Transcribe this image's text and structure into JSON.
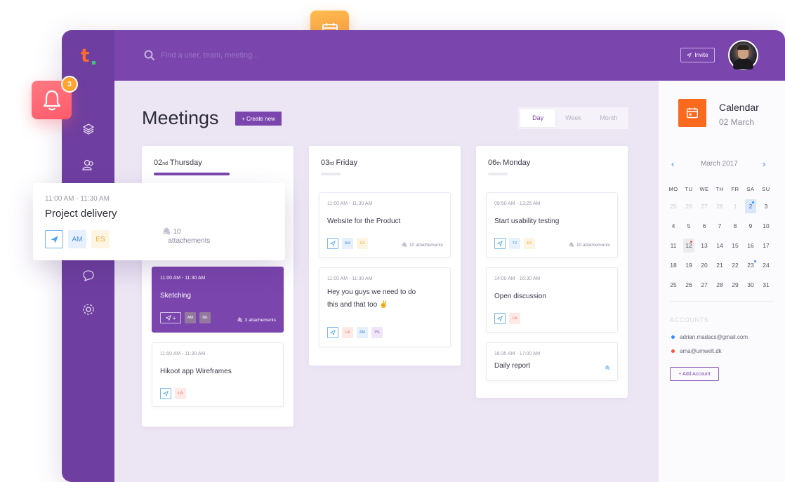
{
  "app": {
    "logo_letter": "t",
    "brand_color": "#7a45ad",
    "accent_color": "#fa6a1e"
  },
  "topbar": {
    "search_placeholder": "Find a user, team, meeting...",
    "invite_label": "Invite"
  },
  "sidebar": {
    "icons": [
      "layers-icon",
      "users-icon",
      "chat-icon",
      "settings-icon"
    ]
  },
  "notifications": {
    "count": "3"
  },
  "meetings": {
    "title": "Meetings",
    "create_label": "+ Create new",
    "views": [
      "Day",
      "Week",
      "Month"
    ],
    "active_view": "Day"
  },
  "columns": [
    {
      "day_num": "02",
      "day_suffix": "nd",
      "day_name": "Thursday",
      "cards": [
        {
          "time": "11:00 AM - 11:30 AM",
          "title": "Sketching",
          "attachments": "3 attachements",
          "chips": [
            "AM",
            "BK"
          ]
        },
        {
          "time": "11:00 AM - 11:30 AM",
          "title": "Hikoot app Wireframes",
          "chips": [
            "LA"
          ]
        }
      ]
    },
    {
      "day_num": "03",
      "day_suffix": "rd",
      "day_name": "Friday",
      "cards": [
        {
          "time": "11:00 AM - 11:30 AM",
          "title": "Website for the Product",
          "attachments": "10 attachements",
          "chips": [
            "AM",
            "ES"
          ]
        },
        {
          "time": "11:00 AM - 11:30 AM",
          "title_line1": "Hey you guys we need to do",
          "title_line2": "this and that too ✌",
          "chips": [
            "LA",
            "AM",
            "PS"
          ]
        }
      ]
    },
    {
      "day_num": "06",
      "day_suffix": "th",
      "day_name": "Monday",
      "cards": [
        {
          "time": "09:50 AM - 13:25 AM",
          "title": "Start usability testing",
          "attachments": "10 attachements",
          "chips": [
            "TX",
            "ES"
          ]
        },
        {
          "time": "14:00 AM - 16:30 AM",
          "title": "Open discussion",
          "chips": [
            "LA"
          ]
        },
        {
          "time": "16:35 AM - 17:00 AM",
          "title": "Daily report"
        }
      ]
    }
  ],
  "popup": {
    "time": "11:00 AM - 11:30 AM",
    "title": "Project delivery",
    "chips": [
      "AM",
      "ES"
    ],
    "attach_count": "10",
    "attach_label": "attachements"
  },
  "calendar": {
    "title": "Calendar",
    "date": "02 March",
    "month_label": "March 2017",
    "weekdays": [
      "MO",
      "TU",
      "WE",
      "TH",
      "FR",
      "SA",
      "SU"
    ],
    "weeks": [
      [
        "25",
        "26",
        "27",
        "28",
        "1",
        "2",
        "3"
      ],
      [
        "4",
        "5",
        "6",
        "7",
        "8",
        "9",
        "10"
      ],
      [
        "11",
        "12",
        "13",
        "14",
        "15",
        "16",
        "17"
      ],
      [
        "18",
        "19",
        "20",
        "21",
        "22",
        "23",
        "24"
      ],
      [
        "25",
        "26",
        "27",
        "28",
        "29",
        "30",
        "31"
      ]
    ],
    "selected_day": "2"
  },
  "accounts": {
    "heading": "ACCOUNTS",
    "items": [
      {
        "email": "adrian.madacs@gmail.com",
        "color": "#3d8cf0"
      },
      {
        "email": "ama@umwelt.dk",
        "color": "#ee5a3e"
      }
    ],
    "add_label": "+ Add Account"
  }
}
